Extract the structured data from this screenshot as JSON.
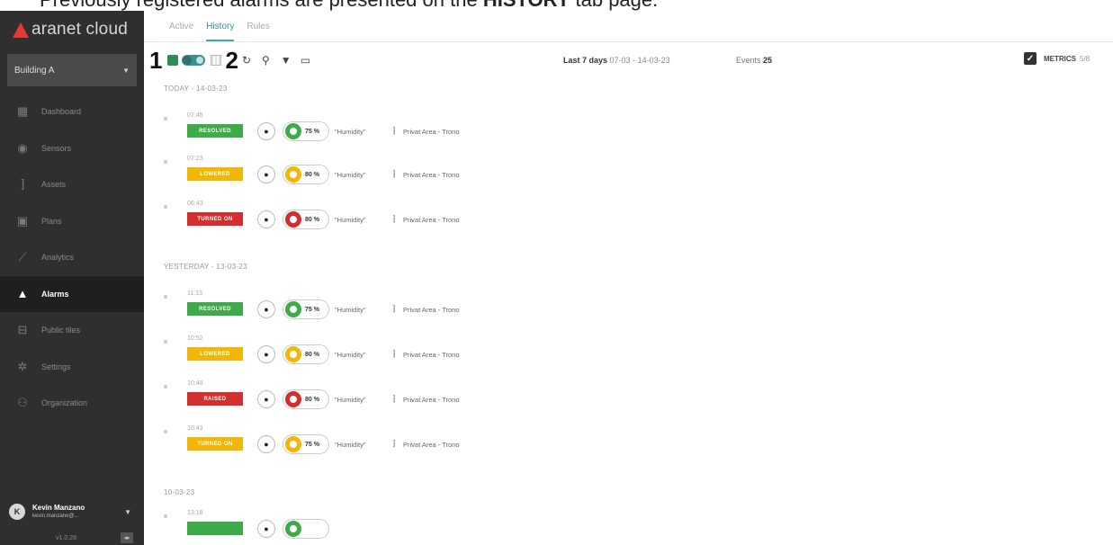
{
  "caption": {
    "prefix": "Previously registered alarms are presented on the ",
    "bold": "HISTORY",
    "suffix": " tab page."
  },
  "sidebar": {
    "logo_text": "aranet cloud",
    "building": "Building A",
    "items": [
      {
        "label": "Dashboard",
        "icon": "dashboard-icon"
      },
      {
        "label": "Sensors",
        "icon": "sensor-icon"
      },
      {
        "label": "Assets",
        "icon": "asset-icon"
      },
      {
        "label": "Plans",
        "icon": "plan-icon"
      },
      {
        "label": "Analytics",
        "icon": "analytics-icon"
      },
      {
        "label": "Alarms",
        "icon": "alarm-icon"
      },
      {
        "label": "Public tiles",
        "icon": "public-tiles-icon"
      },
      {
        "label": "Settings",
        "icon": "gear-icon"
      },
      {
        "label": "Organization",
        "icon": "organization-icon"
      }
    ],
    "user": {
      "initial": "K",
      "name": "Kevin Manzano",
      "email": "kevin.manzano@..."
    },
    "version": "v1.0.28"
  },
  "tabs": [
    "Active",
    "History",
    "Rules"
  ],
  "toolbar": {
    "marker1": "1",
    "marker2": "2",
    "range_label": "Last 7 days",
    "range_dates": "07-03 - 14-03-23",
    "events_label": "Events",
    "events_count": "25",
    "metrics_label": "METRICS",
    "metrics_count": "5/8"
  },
  "groups": [
    {
      "label": "TODAY - 14-03-23",
      "events": [
        {
          "time": "07:46",
          "status": "RESOLVED",
          "color": "green",
          "value": "75 %",
          "metric": "\"Humidity\"",
          "area": "Privat Area - Trono"
        },
        {
          "time": "07:23",
          "status": "LOWERED",
          "color": "yellow",
          "value": "80 %",
          "metric": "\"Humidity\"",
          "area": "Privat Area - Trono"
        },
        {
          "time": "06:43",
          "status": "TURNED ON",
          "color": "red",
          "value": "80 %",
          "metric": "\"Humidity\"",
          "area": "Privat Area - Trono"
        }
      ]
    },
    {
      "label": "YESTERDAY - 13-03-23",
      "events": [
        {
          "time": "11:13",
          "status": "RESOLVED",
          "color": "green",
          "value": "75 %",
          "metric": "\"Humidity\"",
          "area": "Privat Area - Trono"
        },
        {
          "time": "10:52",
          "status": "LOWERED",
          "color": "yellow",
          "value": "80 %",
          "metric": "\"Humidity\"",
          "area": "Privat Area - Trono"
        },
        {
          "time": "10:48",
          "status": "RAISED",
          "color": "red",
          "value": "80 %",
          "metric": "\"Humidity\"",
          "area": "Privat Area - Trono"
        },
        {
          "time": "10:43",
          "status": "TURNED ON",
          "color": "yellow",
          "value": "75 %",
          "metric": "\"Humidity\"",
          "area": "Privat Area - Trono"
        }
      ]
    },
    {
      "label": "10-03-23",
      "events": [
        {
          "time": "13:18",
          "status": "",
          "color": "green",
          "value": "",
          "metric": "",
          "area": ""
        }
      ]
    }
  ]
}
